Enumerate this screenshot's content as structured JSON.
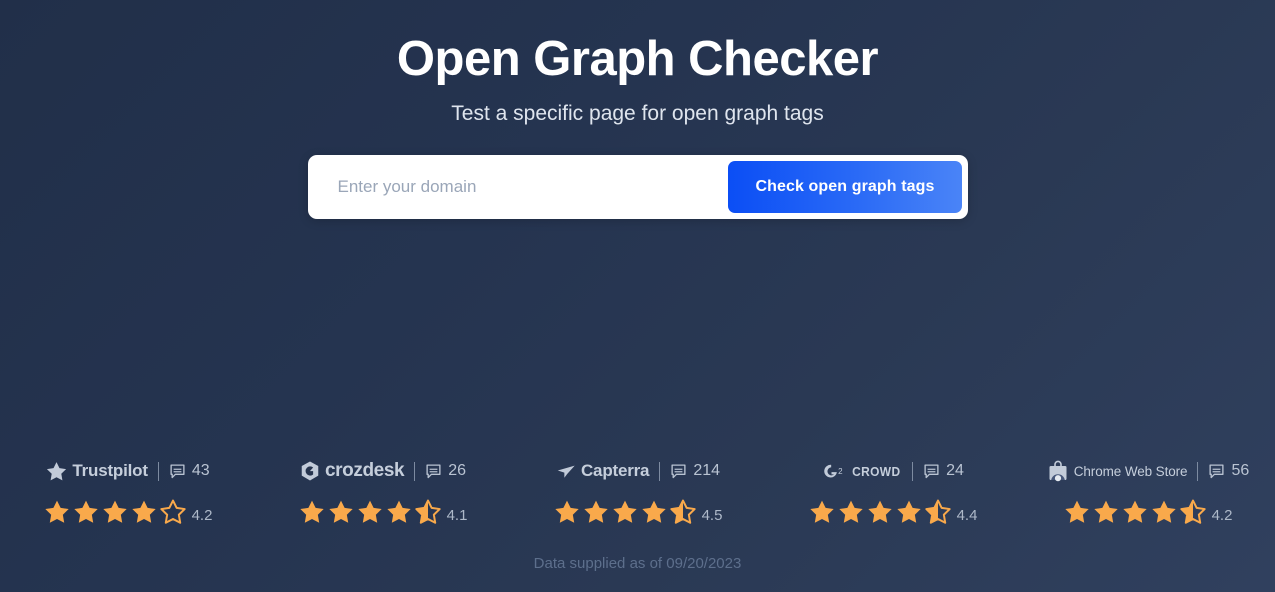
{
  "hero": {
    "title": "Open Graph Checker",
    "subtitle": "Test a specific page for open graph tags"
  },
  "search": {
    "placeholder": "Enter your domain",
    "value": "",
    "button_label": "Check open graph tags"
  },
  "colors": {
    "background_start": "#212f49",
    "background_end": "#30405e",
    "button_gradient_start": "#0b4ef5",
    "button_gradient_end": "#4a84f7",
    "star_filled": "#f9a94b",
    "brand_text": "#c5cedb"
  },
  "ratings": [
    {
      "brand": "Trustpilot",
      "logo_icon": "trustpilot-star-icon",
      "review_icon": "comment-icon",
      "review_count": "43",
      "score": "4.2",
      "stars_full": 4,
      "stars_half": 0,
      "stars_empty": 1
    },
    {
      "brand": "crozdesk",
      "logo_icon": "crozdesk-hexagon-icon",
      "review_icon": "comment-icon",
      "review_count": "26",
      "score": "4.1",
      "stars_full": 4,
      "stars_half": 1,
      "stars_empty": 0
    },
    {
      "brand": "Capterra",
      "logo_icon": "capterra-paper-plane-icon",
      "review_icon": "comment-icon",
      "review_count": "214",
      "score": "4.5",
      "stars_full": 4,
      "stars_half": 1,
      "stars_empty": 0
    },
    {
      "brand": "CROWD",
      "logo_icon": "g2-crowd-icon",
      "review_icon": "comment-icon",
      "review_count": "24",
      "score": "4.4",
      "stars_full": 4,
      "stars_half": 1,
      "stars_empty": 0
    },
    {
      "brand": "Chrome Web Store",
      "logo_icon": "chrome-web-store-bag-icon",
      "review_icon": "comment-icon",
      "review_count": "56",
      "score": "4.2",
      "stars_full": 4,
      "stars_half": 1,
      "stars_empty": 0
    }
  ],
  "footer": {
    "note": "Data supplied as of 09/20/2023"
  }
}
